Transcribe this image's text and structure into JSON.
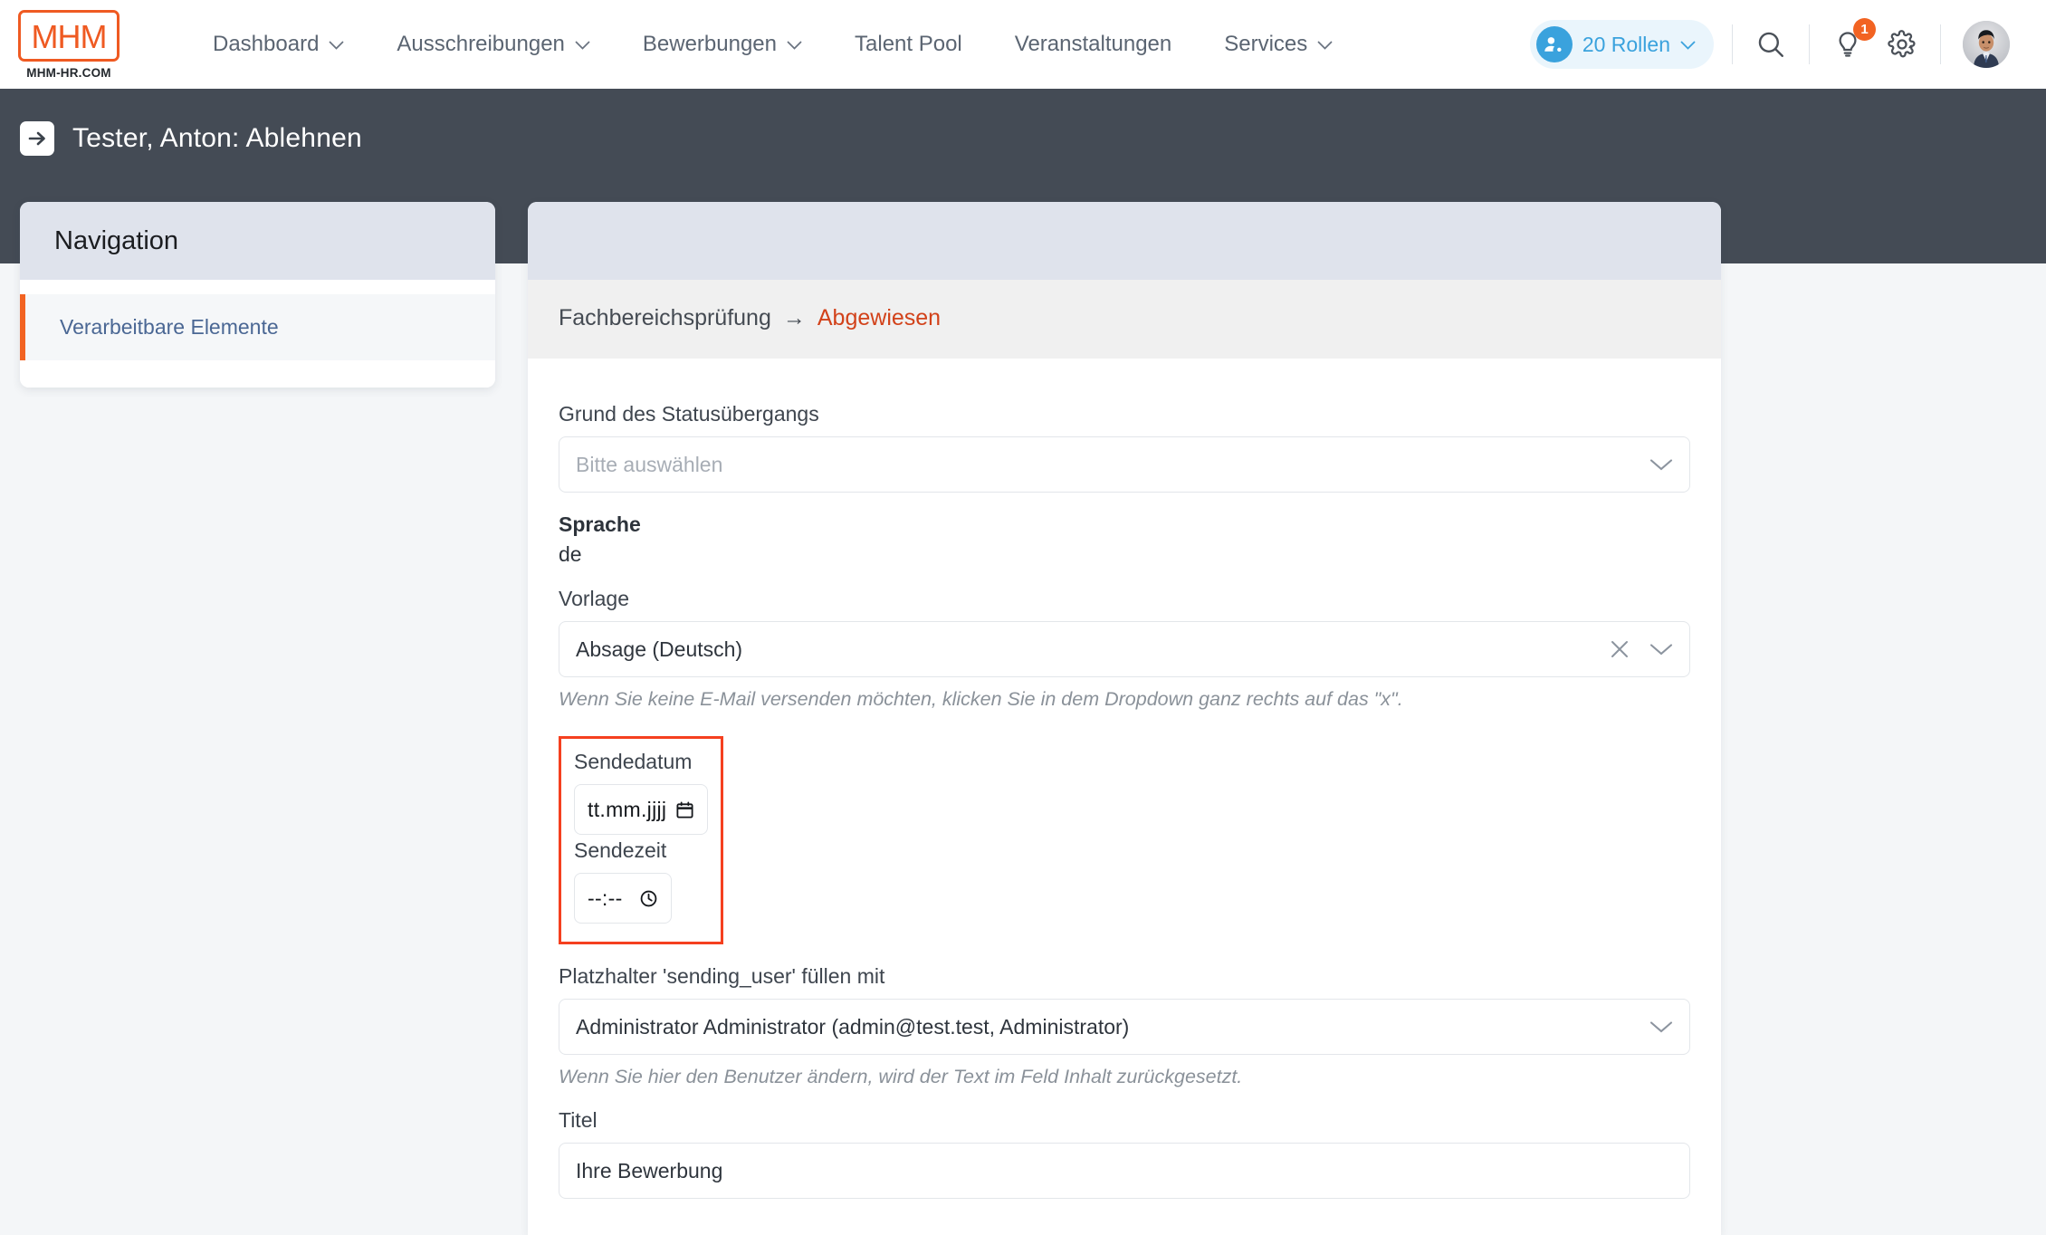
{
  "brand": {
    "logo_text": "MHM",
    "logo_subtitle": "MHM-HR.COM",
    "accent_color": "#ef5a22"
  },
  "topnav": {
    "items": [
      {
        "label": "Dashboard",
        "has_dropdown": true
      },
      {
        "label": "Ausschreibungen",
        "has_dropdown": true
      },
      {
        "label": "Bewerbungen",
        "has_dropdown": true
      },
      {
        "label": "Talent Pool",
        "has_dropdown": false
      },
      {
        "label": "Veranstaltungen",
        "has_dropdown": false
      },
      {
        "label": "Services",
        "has_dropdown": true
      }
    ],
    "roles_pill": {
      "label": "20 Rollen",
      "icon": "user-cog-icon",
      "color": "#3aa2dd"
    },
    "icons": [
      {
        "name": "search-icon"
      },
      {
        "name": "lightbulb-icon",
        "badge": "1"
      },
      {
        "name": "gear-icon"
      }
    ],
    "avatar": {
      "name": "user-avatar"
    }
  },
  "page_header": {
    "back_icon": "arrow-right-box-icon",
    "title": "Tester, Anton: Ablehnen"
  },
  "sidebar": {
    "title": "Navigation",
    "items": [
      {
        "label": "Verarbeitbare Elemente",
        "active": true
      }
    ]
  },
  "main": {
    "breadcrumb": {
      "from": "Fachbereichsprüfung",
      "arrow": "→",
      "to": "Abgewiesen",
      "to_color": "#d2421a"
    },
    "fields": {
      "reason": {
        "label": "Grund des Statusübergangs",
        "placeholder": "Bitte auswählen",
        "value": ""
      },
      "language": {
        "label": "Sprache",
        "value": "de"
      },
      "template": {
        "label": "Vorlage",
        "value": "Absage (Deutsch)",
        "hint": "Wenn Sie keine E-Mail versenden möchten, klicken Sie in dem Dropdown ganz rechts auf das \"x\".",
        "clear_icon": "close-icon",
        "chevron_icon": "chevron-down-icon"
      },
      "send_date": {
        "label": "Sendedatum",
        "placeholder": "tt.mm.jjjj",
        "value": "",
        "icon": "calendar-icon"
      },
      "send_time": {
        "label": "Sendezeit",
        "placeholder": "--:--",
        "value": "",
        "icon": "clock-icon"
      },
      "sending_user": {
        "label": "Platzhalter 'sending_user' füllen mit",
        "value": "Administrator Administrator (admin@test.test, Administrator)",
        "hint": "Wenn Sie hier den Benutzer ändern, wird der Text im Feld Inhalt zurückgesetzt."
      },
      "title": {
        "label": "Titel",
        "value": "Ihre Bewerbung"
      }
    },
    "highlight_color": "#f5401f"
  }
}
